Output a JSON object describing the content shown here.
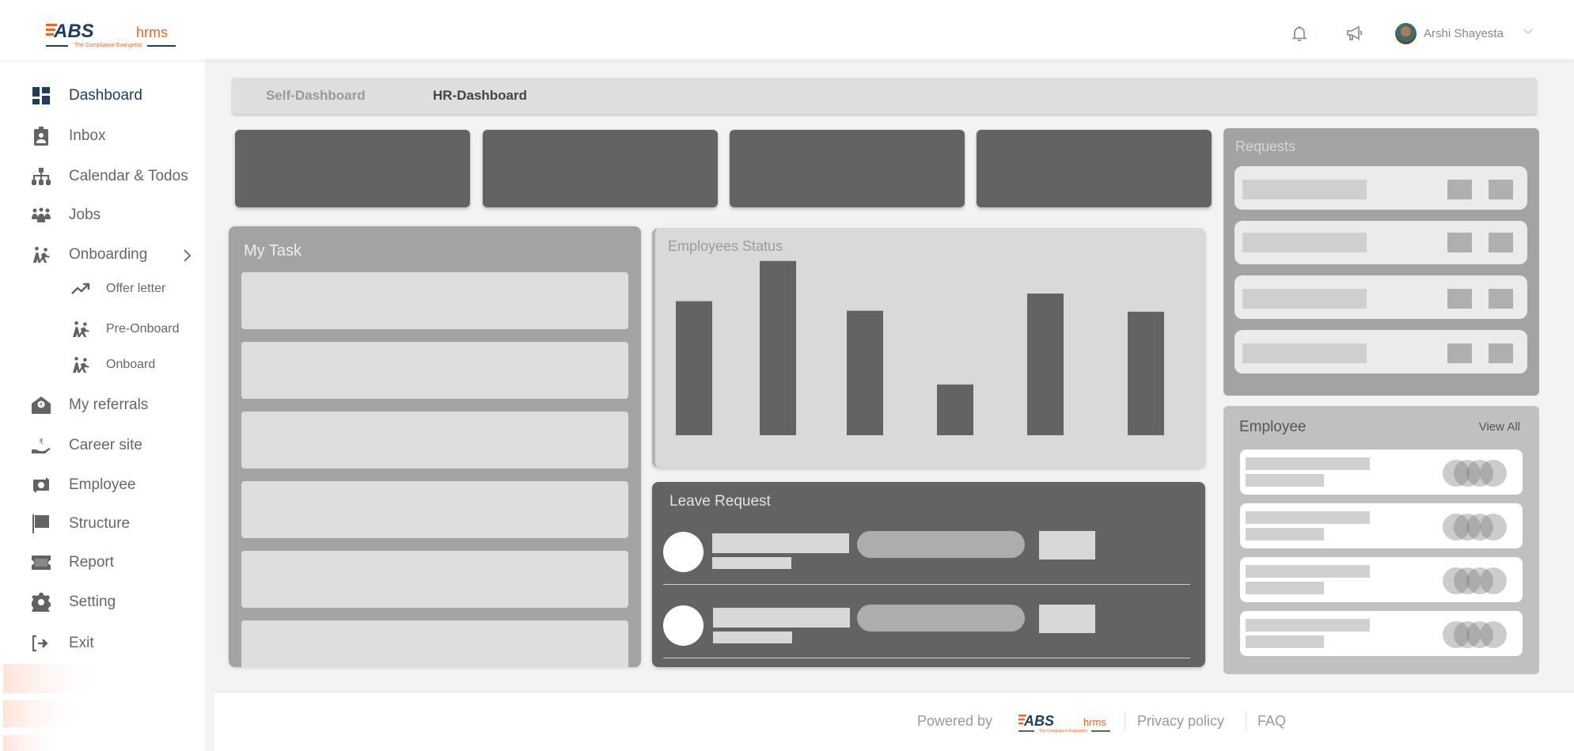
{
  "header": {
    "brand": "ABS hrms",
    "brand_tagline": "The Compliance Evangelist",
    "user_name": "Arshi Shayesta",
    "icons": [
      "bell-icon",
      "megaphone-icon",
      "chevron-down-icon"
    ]
  },
  "sidebar": {
    "items": [
      {
        "label": "Dashboard",
        "icon": "dashboard-icon",
        "active": true
      },
      {
        "label": "Inbox",
        "icon": "clipboard-user-icon"
      },
      {
        "label": "Calendar & Todos",
        "icon": "sitemap-icon"
      },
      {
        "label": "Jobs",
        "icon": "people-group-icon"
      },
      {
        "label": "Onboarding",
        "icon": "people-onboarding-icon",
        "expanded": true,
        "children": [
          {
            "label": "Offer letter",
            "icon": "trend-up-icon"
          },
          {
            "label": "Pre-Onboard",
            "icon": "people-onboarding-icon"
          },
          {
            "label": "Onboard",
            "icon": "people-onboarding-icon"
          }
        ]
      },
      {
        "label": "My referrals",
        "icon": "envelope-rupee-icon"
      },
      {
        "label": "Career site",
        "icon": "hand-rupee-icon"
      },
      {
        "label": "Employee",
        "icon": "money-exchange-icon"
      },
      {
        "label": "Structure",
        "icon": "flag-icon"
      },
      {
        "label": "Report",
        "icon": "ticket-icon"
      },
      {
        "label": "Setting",
        "icon": "gear-icon"
      },
      {
        "label": "Exit",
        "icon": "sign-out-icon"
      }
    ]
  },
  "tabs": [
    {
      "label": "Self-Dashboard",
      "active": false
    },
    {
      "label": "HR-Dashboard",
      "active": true
    }
  ],
  "panels": {
    "my_task": {
      "title": "My Task"
    },
    "employees_status": {
      "title": "Employees Status"
    },
    "leave_request": {
      "title": "Leave Request"
    },
    "requests": {
      "title": "Requests"
    },
    "employee": {
      "title": "Employee",
      "view_all": "View All"
    }
  },
  "chart_data": {
    "type": "bar",
    "title": "Employees Status",
    "categories": [
      "",
      "",
      "",
      "",
      "",
      ""
    ],
    "values": [
      140,
      182,
      130,
      53,
      148,
      129
    ],
    "xlabel": "",
    "ylabel": "",
    "ylim": [
      0,
      200
    ],
    "grid": false,
    "bar_color": "#636363"
  },
  "footer": {
    "powered_by": "Powered by",
    "brand": "ABS hrms",
    "privacy": "Privacy policy",
    "faq": "FAQ"
  },
  "colors": {
    "brand_navy": "#1e3d63",
    "brand_orange": "#f26322",
    "skeleton_dark": "#636363",
    "skeleton_mid": "#a3a3a3"
  }
}
